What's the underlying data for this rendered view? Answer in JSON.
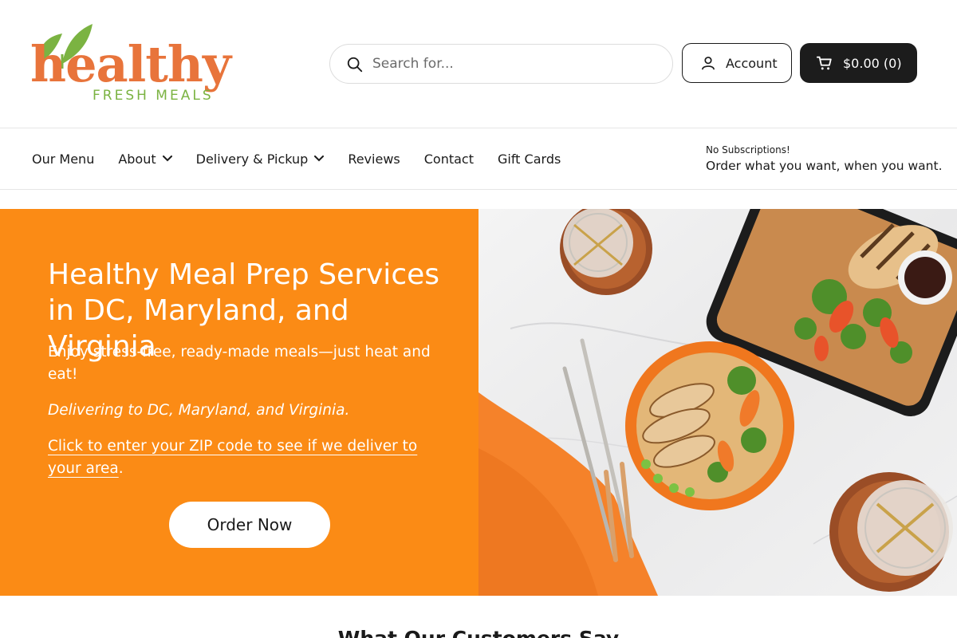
{
  "brand": {
    "logo_word": "healthy",
    "logo_sub": "FRESH MEALS",
    "primary_color": "#fb8b15",
    "logo_orange": "#e8743b",
    "leaf_green": "#7bb342"
  },
  "header": {
    "search_placeholder": "Search for...",
    "account_label": "Account",
    "cart_label": "$0.00 (0)"
  },
  "nav": {
    "items": [
      {
        "label": "Our Menu",
        "dropdown": false
      },
      {
        "label": "About",
        "dropdown": true
      },
      {
        "label": "Delivery & Pickup",
        "dropdown": true
      },
      {
        "label": "Reviews",
        "dropdown": false
      },
      {
        "label": "Contact",
        "dropdown": false
      },
      {
        "label": "Gift Cards",
        "dropdown": false
      }
    ],
    "note_small": "No Subscriptions!",
    "note_main": "Order what you want, when you want."
  },
  "hero": {
    "title": "Healthy Meal Prep Services in DC, Maryland, and Virginia",
    "subtitle": "Enjoy stress-free, ready-made meals—just heat and eat!",
    "italic": "Delivering to DC, Maryland, and Virginia.",
    "zip_link": "Click to enter your ZIP code to see if we deliver to your area",
    "zip_link_suffix": ".",
    "cta": "Order Now"
  },
  "section": {
    "title": "What Our Customers Say"
  }
}
